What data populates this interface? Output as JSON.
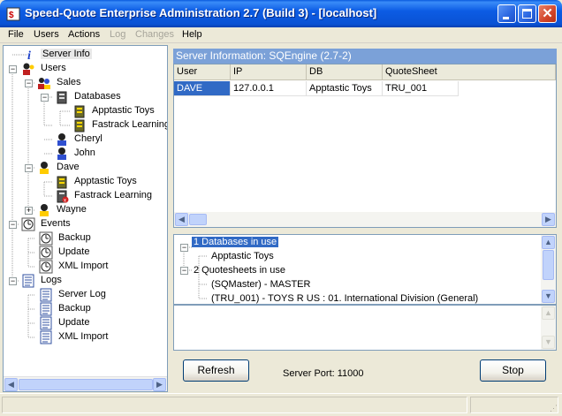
{
  "window": {
    "title": "Speed-Quote Enterprise Administration 2.7 (Build 3) - [localhost]"
  },
  "menu": {
    "items": [
      {
        "label": "File",
        "enabled": true
      },
      {
        "label": "Users",
        "enabled": true
      },
      {
        "label": "Actions",
        "enabled": true
      },
      {
        "label": "Log",
        "enabled": false
      },
      {
        "label": "Changes",
        "enabled": false
      },
      {
        "label": "Help",
        "enabled": true
      }
    ]
  },
  "tree": {
    "server_info": "Server Info",
    "users": "Users",
    "sales": "Sales",
    "databases": "Databases",
    "apptastic_toys": "Apptastic Toys",
    "fastrack_learning": "Fastrack Learning",
    "cheryl": "Cheryl",
    "john": "John",
    "dave": "Dave",
    "dave_apptastic": "Apptastic Toys",
    "dave_fastrack": "Fastrack Learning",
    "wayne": "Wayne",
    "events": "Events",
    "backup": "Backup",
    "update": "Update",
    "xml_import": "XML Import",
    "logs": "Logs",
    "server_log": "Server Log",
    "logs_backup": "Backup",
    "logs_update": "Update",
    "logs_xml_import": "XML Import"
  },
  "server_panel": {
    "header": "Server Information: SQEngine (2.7-2)",
    "columns": [
      "User",
      "IP",
      "DB",
      "QuoteSheet"
    ],
    "rows": [
      [
        "DAVE",
        "127.0.0.1",
        "Apptastic Toys",
        "TRU_001"
      ]
    ]
  },
  "info_tree": {
    "databases_in_use": "1 Databases in use",
    "db_item": "Apptastic Toys",
    "quotesheets_in_use": "2 Quotesheets in use",
    "qs_item_1": "(SQMaster) - MASTER",
    "qs_item_2": "(TRU_001) - TOYS R US :  01. International Division (General)"
  },
  "bottom": {
    "refresh_label": "Refresh",
    "server_port": "Server Port: 11000",
    "stop_label": "Stop"
  },
  "colors": {
    "title_bar": "#0a52d4",
    "header_blue": "#7ba1d8",
    "selection": "#316ac5"
  }
}
